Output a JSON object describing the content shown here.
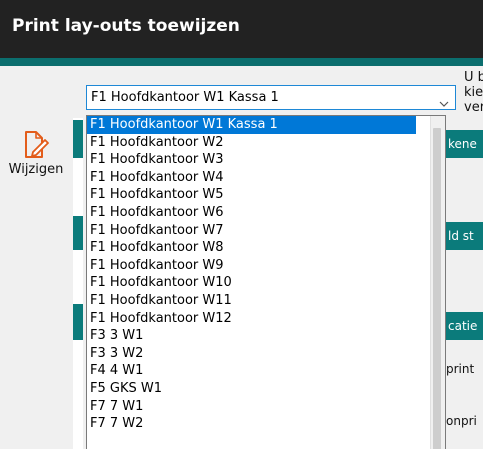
{
  "window": {
    "title": "Print lay-outs toewijzen"
  },
  "toolbar": {
    "edit_label": "Wijzigen"
  },
  "combo": {
    "selected": "F1 Hoofdkantoor W1 Kassa 1"
  },
  "dropdown": {
    "options": [
      "F1 Hoofdkantoor W1 Kassa 1",
      "F1 Hoofdkantoor W2",
      "F1 Hoofdkantoor W3",
      "F1 Hoofdkantoor W4",
      "F1 Hoofdkantoor W5",
      "F1 Hoofdkantoor W6",
      "F1 Hoofdkantoor W7",
      "F1 Hoofdkantoor W8",
      "F1 Hoofdkantoor W9",
      "F1 Hoofdkantoor W10",
      "F1 Hoofdkantoor W11",
      "F1 Hoofdkantoor W12",
      "F3 3 W1",
      "F3 3 W2",
      "F4 4 W1",
      "F5 GKS W1",
      "F7 7 W1",
      "F7 7 W2"
    ]
  },
  "right_panel": {
    "info_lines": [
      "U b",
      "kie",
      "ver"
    ],
    "headers": [
      "kene",
      "ld st",
      "catie"
    ],
    "labels": [
      "print",
      "onpri"
    ]
  },
  "colors": {
    "titlebar": "#222222",
    "accent": "#0b6e6e",
    "selection": "#0078d7",
    "edit_icon": "#e35d1b"
  }
}
